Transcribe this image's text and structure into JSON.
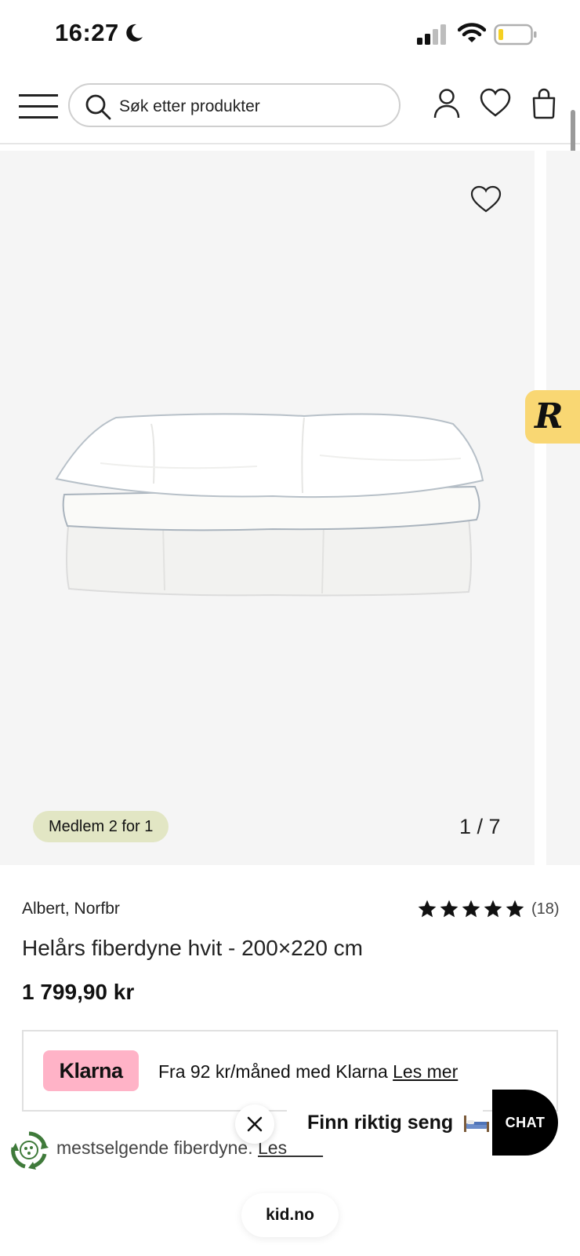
{
  "status_bar": {
    "time": "16:27",
    "icons": [
      "moon-icon",
      "cellular-signal-icon",
      "wifi-icon",
      "battery-low-icon"
    ]
  },
  "header": {
    "search_placeholder": "Søk etter produkter",
    "icons": [
      "menu-icon",
      "search-icon",
      "user-icon",
      "heart-icon",
      "shopping-bag-icon"
    ]
  },
  "gallery": {
    "badge": "Medlem 2 for 1",
    "counter": "1 / 7",
    "side_badge_letter": "R"
  },
  "product": {
    "brand": "Albert, Norfbr",
    "rating_stars": 5,
    "review_count": "(18)",
    "title": "Helårs fiberdyne hvit - 200×220 cm",
    "price": "1 799,90 kr"
  },
  "klarna": {
    "logo": "Klarna",
    "text": "Fra 92 kr/måned med Klarna",
    "link": "Les mer"
  },
  "eco_row": {
    "text": "mestselgende fiberdyne.",
    "link": "Les mer"
  },
  "popup": {
    "text": "Finn riktig seng",
    "chat_label": "CHAT"
  },
  "browser": {
    "url": "kid.no"
  },
  "colors": {
    "member_badge": "#e2e6c4",
    "klarna_pink": "#ffb3c7",
    "r_badge": "#f9d773",
    "eco_green": "#3f7a3a"
  }
}
